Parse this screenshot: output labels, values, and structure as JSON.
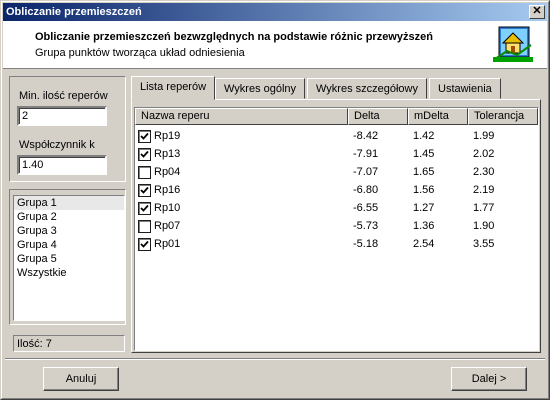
{
  "window": {
    "title": "Obliczanie przemieszczeń",
    "close_label": "✕"
  },
  "header": {
    "title": "Obliczanie przemieszczeń bezwzględnych na podstawie różnic przewyższeń",
    "subtitle": "Grupa punktów tworząca układ odniesienia",
    "icon": "chart-house-icon"
  },
  "left": {
    "min_label": "Min. ilość reperów",
    "min_value": "2",
    "coef_label": "Współczynnik k",
    "coef_value": "1.40",
    "groups": [
      "Grupa 1",
      "Grupa 2",
      "Grupa 3",
      "Grupa 4",
      "Grupa 5",
      "Wszystkie"
    ],
    "selected_group": "Grupa 1",
    "count_text": "Ilość: 7"
  },
  "tabs": [
    {
      "label": "Lista reperów",
      "active": true
    },
    {
      "label": "Wykres ogólny",
      "active": false
    },
    {
      "label": "Wykres szczegółowy",
      "active": false
    },
    {
      "label": "Ustawienia",
      "active": false
    }
  ],
  "table": {
    "columns": [
      "Nazwa reperu",
      "Delta",
      "mDelta",
      "Tolerancja"
    ],
    "rows": [
      {
        "checked": true,
        "name": "Rp19",
        "delta": "-8.42",
        "mdelta": "1.42",
        "tol": "1.99"
      },
      {
        "checked": true,
        "name": "Rp13",
        "delta": "-7.91",
        "mdelta": "1.45",
        "tol": "2.02"
      },
      {
        "checked": false,
        "name": "Rp04",
        "delta": "-7.07",
        "mdelta": "1.65",
        "tol": "2.30"
      },
      {
        "checked": true,
        "name": "Rp16",
        "delta": "-6.80",
        "mdelta": "1.56",
        "tol": "2.19"
      },
      {
        "checked": true,
        "name": "Rp10",
        "delta": "-6.55",
        "mdelta": "1.27",
        "tol": "1.77"
      },
      {
        "checked": false,
        "name": "Rp07",
        "delta": "-5.73",
        "mdelta": "1.36",
        "tol": "1.90"
      },
      {
        "checked": true,
        "name": "Rp01",
        "delta": "-5.18",
        "mdelta": "2.54",
        "tol": "3.55"
      }
    ]
  },
  "buttons": {
    "cancel": "Anuluj",
    "next": "Dalej >"
  }
}
